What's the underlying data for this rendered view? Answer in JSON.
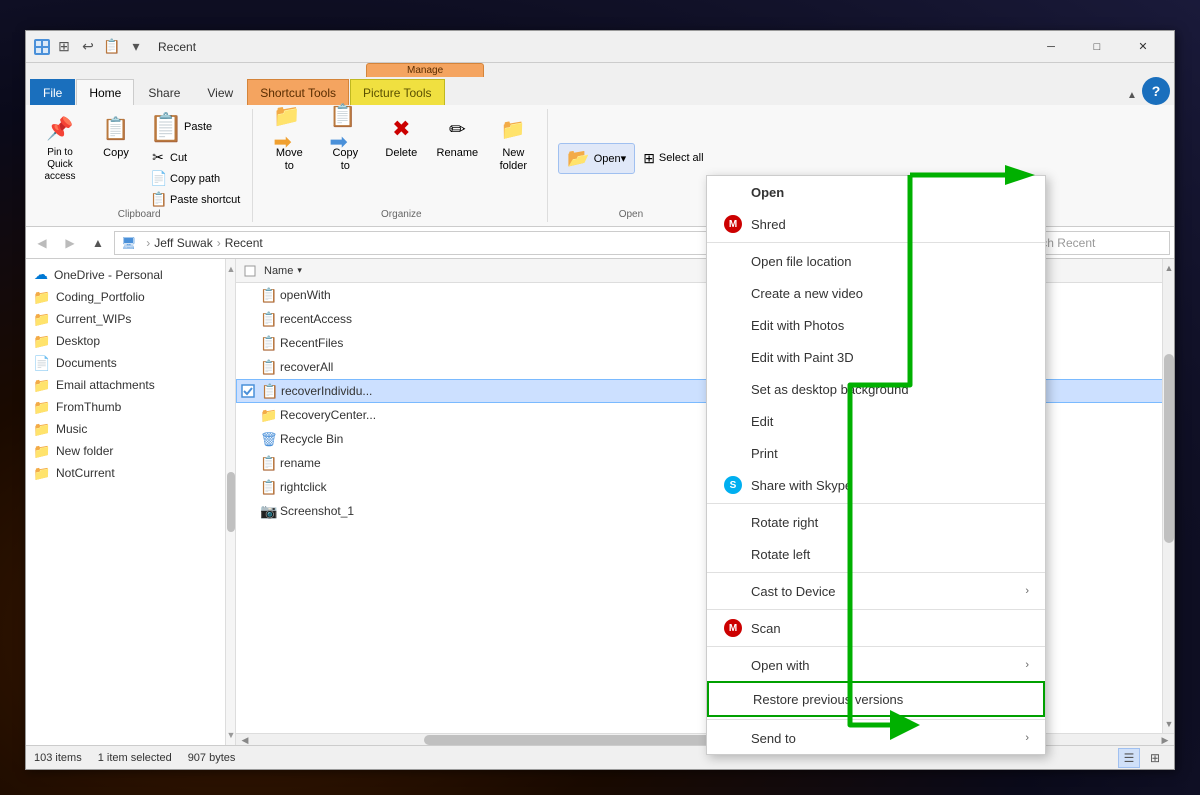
{
  "window": {
    "title": "Recent",
    "controls": {
      "minimize": "─",
      "maximize": "□",
      "close": "✕"
    }
  },
  "ribbon": {
    "tabs": [
      {
        "id": "file",
        "label": "File",
        "style": "file"
      },
      {
        "id": "home",
        "label": "Home",
        "style": "active"
      },
      {
        "id": "share",
        "label": "Share",
        "style": "normal"
      },
      {
        "id": "view",
        "label": "View",
        "style": "normal"
      },
      {
        "id": "manage-shortcut",
        "label": "Shortcut Tools",
        "style": "manage-orange"
      },
      {
        "id": "manage-picture",
        "label": "Picture Tools",
        "style": "manage-yellow"
      },
      {
        "id": "manage-label-shortcut",
        "label": "Manage",
        "style": "manage-orange-label"
      },
      {
        "id": "manage-label-picture",
        "label": "Manage",
        "style": "manage-yellow-label"
      }
    ],
    "groups": {
      "clipboard": {
        "label": "Clipboard",
        "pin_label": "Pin to Quick\naccess",
        "copy_label": "Copy",
        "paste_label": "Paste",
        "cut_label": "Cut",
        "copy_path_label": "Copy path",
        "paste_shortcut_label": "Paste shortcut"
      },
      "organize": {
        "label": "Organize",
        "move_to_label": "Move\nto",
        "copy_to_label": "Copy\nto",
        "delete_label": "Delete",
        "rename_label": "Rename",
        "new_folder_label": "New\nfolder"
      },
      "open": {
        "label": "Open",
        "open_label": "Open▾",
        "select_all_label": "Select all"
      }
    }
  },
  "address_bar": {
    "path_parts": [
      "Jeff Suwak",
      "Recent"
    ],
    "search_placeholder": "Search Recent"
  },
  "sidebar": {
    "items": [
      {
        "id": "onedrive",
        "label": "OneDrive - Personal",
        "icon": "☁",
        "type": "onedrive"
      },
      {
        "id": "coding",
        "label": "Coding_Portfolio",
        "icon": "📁",
        "type": "folder-yellow"
      },
      {
        "id": "current-wips",
        "label": "Current_WIPs",
        "icon": "📁",
        "type": "folder-yellow"
      },
      {
        "id": "desktop",
        "label": "Desktop",
        "icon": "📁",
        "type": "folder-blue"
      },
      {
        "id": "documents",
        "label": "Documents",
        "icon": "📄",
        "type": "document"
      },
      {
        "id": "email",
        "label": "Email attachments",
        "icon": "📁",
        "type": "folder-yellow"
      },
      {
        "id": "fromthumb",
        "label": "FromThumb",
        "icon": "📁",
        "type": "folder-yellow"
      },
      {
        "id": "music",
        "label": "Music",
        "icon": "📁",
        "type": "folder-yellow"
      },
      {
        "id": "new-folder",
        "label": "New folder",
        "icon": "📁",
        "type": "folder-yellow"
      },
      {
        "id": "notcurrent",
        "label": "NotCurrent",
        "icon": "📁",
        "type": "folder-yellow"
      }
    ]
  },
  "file_list": {
    "column": "Name",
    "items": [
      {
        "name": "openWith",
        "icon": "📋",
        "selected": false,
        "checked": false
      },
      {
        "name": "recentAccess",
        "icon": "📋",
        "selected": false,
        "checked": false
      },
      {
        "name": "RecentFiles",
        "icon": "📋",
        "selected": false,
        "checked": false
      },
      {
        "name": "recoverAll",
        "icon": "📋",
        "selected": false,
        "checked": false
      },
      {
        "name": "recoverIndividu...",
        "icon": "📋",
        "selected": true,
        "checked": true
      },
      {
        "name": "RecoveryCenter...",
        "icon": "📁",
        "selected": false,
        "checked": false
      },
      {
        "name": "Recycle Bin",
        "icon": "🗑",
        "selected": false,
        "checked": false
      },
      {
        "name": "rename",
        "icon": "📋",
        "selected": false,
        "checked": false
      },
      {
        "name": "rightclick",
        "icon": "📋",
        "selected": false,
        "checked": false
      },
      {
        "name": "Screenshot_1",
        "icon": "📷",
        "selected": false,
        "checked": false
      }
    ]
  },
  "status_bar": {
    "count": "103 items",
    "selected": "1 item selected",
    "size": "907 bytes"
  },
  "context_menu": {
    "items": [
      {
        "id": "open",
        "label": "Open",
        "icon": "",
        "style": "bold",
        "arrow": false
      },
      {
        "id": "shred",
        "label": "Shred",
        "icon": "mcafee",
        "style": "normal",
        "arrow": false
      },
      {
        "id": "sep1",
        "type": "separator"
      },
      {
        "id": "open-file-location",
        "label": "Open file location",
        "icon": "",
        "style": "normal",
        "arrow": false
      },
      {
        "id": "create-video",
        "label": "Create a new video",
        "icon": "",
        "style": "normal",
        "arrow": false
      },
      {
        "id": "edit-photos",
        "label": "Edit with Photos",
        "icon": "",
        "style": "normal",
        "arrow": false
      },
      {
        "id": "edit-paint3d",
        "label": "Edit with Paint 3D",
        "icon": "",
        "style": "normal",
        "arrow": false
      },
      {
        "id": "set-desktop-bg",
        "label": "Set as desktop background",
        "icon": "",
        "style": "normal",
        "arrow": false
      },
      {
        "id": "edit",
        "label": "Edit",
        "icon": "",
        "style": "normal",
        "arrow": false
      },
      {
        "id": "print",
        "label": "Print",
        "icon": "",
        "style": "normal",
        "arrow": false
      },
      {
        "id": "share-skype",
        "label": "Share with Skype",
        "icon": "skype",
        "style": "normal",
        "arrow": false
      },
      {
        "id": "sep2",
        "type": "separator"
      },
      {
        "id": "rotate-right",
        "label": "Rotate right",
        "icon": "",
        "style": "normal",
        "arrow": false
      },
      {
        "id": "rotate-left",
        "label": "Rotate left",
        "icon": "",
        "style": "normal",
        "arrow": false
      },
      {
        "id": "sep3",
        "type": "separator"
      },
      {
        "id": "cast",
        "label": "Cast to Device",
        "icon": "",
        "style": "normal",
        "arrow": true
      },
      {
        "id": "sep4",
        "type": "separator"
      },
      {
        "id": "scan",
        "label": "Scan",
        "icon": "mcafee",
        "style": "normal",
        "arrow": false
      },
      {
        "id": "sep5",
        "type": "separator"
      },
      {
        "id": "open-with",
        "label": "Open with",
        "icon": "",
        "style": "normal",
        "arrow": true
      },
      {
        "id": "restore",
        "label": "Restore previous versions",
        "icon": "",
        "style": "highlighted",
        "arrow": false
      },
      {
        "id": "sep6",
        "type": "separator"
      },
      {
        "id": "send-to",
        "label": "Send to",
        "icon": "",
        "style": "normal",
        "arrow": true
      }
    ]
  }
}
